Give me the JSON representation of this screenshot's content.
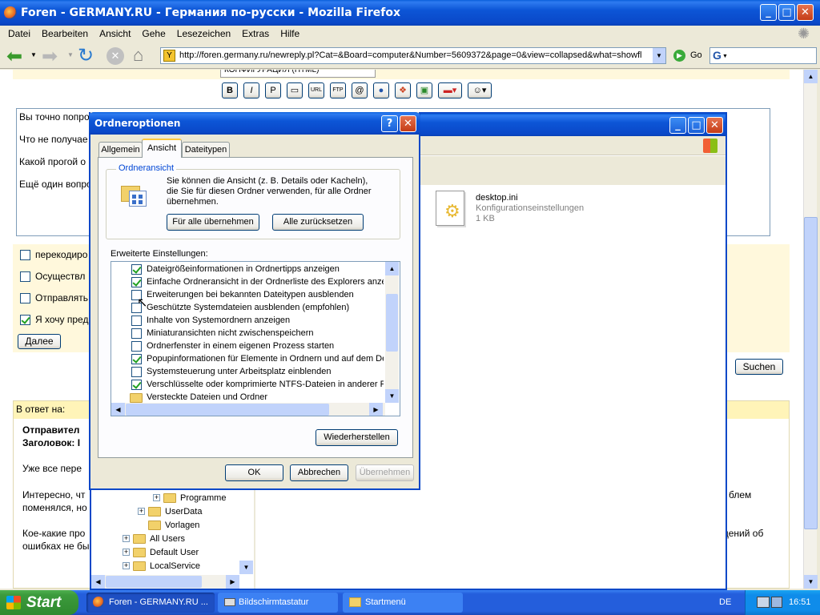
{
  "firefox": {
    "title": "Foren - GERMANY.RU - Германия по-русски - Mozilla Firefox",
    "menu": [
      "Datei",
      "Bearbeiten",
      "Ansicht",
      "Gehe",
      "Lesezeichen",
      "Extras",
      "Hilfe"
    ],
    "url": "http://foren.germany.ru/newreply.pl?Cat=&Board=computer&Number=5609372&page=0&view=collapsed&what=showfl",
    "go_label": "Go"
  },
  "page": {
    "top_field_text": "КОНФИГУРАЦИЯ (HTML)",
    "message_lines": [
      "Вы точно попро",
      "Что не получае",
      "Какой прогой о",
      "Ещё один вопро"
    ],
    "options": [
      {
        "label": "перекодиро",
        "checked": false
      },
      {
        "label": "Осуществл",
        "checked": false
      },
      {
        "label": "Отправлять",
        "checked": false
      },
      {
        "label": "Я хочу пред",
        "checked": true
      }
    ],
    "next_button": "Далее",
    "search_button": "Suchen",
    "reply_header": "В ответ на:",
    "reply_sender": "Отправител",
    "reply_subject": "Заголовок: I",
    "reply_p1": "Уже все пере",
    "reply_p2a": "Интересно, чт",
    "reply_p2b": "поменялся, но",
    "reply_p2c": "блем",
    "reply_p3a": "Кое-какие про",
    "reply_p3b": "ошибках не бы",
    "reply_p3c": "щений об"
  },
  "explorer": {
    "file_name": "desktop.ini",
    "file_type": "Konfigurationseinstellungen",
    "file_size": "1 KB",
    "tree": [
      {
        "label": "Programme",
        "plus": true
      },
      {
        "label": "UserData",
        "plus": true
      },
      {
        "label": "Vorlagen",
        "plus": false
      },
      {
        "label": "All Users",
        "plus": true
      },
      {
        "label": "Default User",
        "plus": true
      },
      {
        "label": "LocalService",
        "plus": true
      }
    ]
  },
  "dialog": {
    "title": "Ordneroptionen",
    "help": "?",
    "tabs": [
      "Allgemein",
      "Ansicht",
      "Dateitypen"
    ],
    "group_title": "Ordneransicht",
    "group_text": "Sie können die Ansicht (z. B. Details oder Kacheln), die Sie für diesen Ordner verwenden, für alle Ordner übernehmen.",
    "apply_all": "Für alle übernehmen",
    "reset_all": "Alle zurücksetzen",
    "advanced_label": "Erweiterte Einstellungen:",
    "settings": [
      {
        "label": "Dateigrößeinformationen in Ordnertipps anzeigen",
        "checked": true
      },
      {
        "label": "Einfache Ordneransicht in der Ordnerliste des Explorers anzeigen",
        "checked": true
      },
      {
        "label": "Erweiterungen bei bekannten Dateitypen ausblenden",
        "checked": false
      },
      {
        "label": "Geschützte Systemdateien ausblenden (empfohlen)",
        "checked": false
      },
      {
        "label": "Inhalte von Systemordnern anzeigen",
        "checked": false
      },
      {
        "label": "Miniaturansichten nicht zwischenspeichern",
        "checked": false
      },
      {
        "label": "Ordnerfenster in einem eigenen Prozess starten",
        "checked": false
      },
      {
        "label": "Popupinformationen für Elemente in Ordnern und auf dem Desktop",
        "checked": true
      },
      {
        "label": "Systemsteuerung unter Arbeitsplatz einblenden",
        "checked": false
      },
      {
        "label": "Verschlüsselte oder komprimierte NTFS-Dateien in anderer Farbe",
        "checked": true
      }
    ],
    "last_item": "Versteckte Dateien und Ordner",
    "restore": "Wiederherstellen",
    "ok": "OK",
    "cancel": "Abbrechen",
    "apply": "Übernehmen"
  },
  "taskbar": {
    "start": "Start",
    "items": [
      "Foren - GERMANY.RU ...",
      "Bildschirmtastatur",
      "Startmenü"
    ],
    "lang": "DE",
    "time": "16:51"
  },
  "colors": {
    "xp_blue": "#0A48C8",
    "taskbar": "#245EDC",
    "start_green": "#3C9A3C",
    "tray": "#0F8CEA"
  }
}
